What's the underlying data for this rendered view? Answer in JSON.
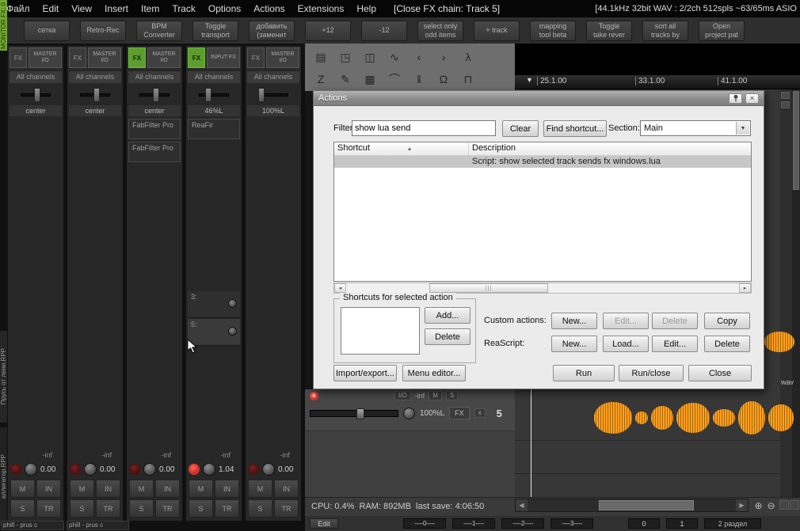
{
  "menu": {
    "items": [
      "Файл",
      "Edit",
      "View",
      "Insert",
      "Item",
      "Track",
      "Options",
      "Actions",
      "Extensions",
      "Help"
    ],
    "context": "[Close FX chain: Track 5]",
    "audio_status": "[44.1kHz 32bit WAV : 2/2ch 512spls ~63/65ms ASIO"
  },
  "toolbar": {
    "buttons": [
      "сетка",
      "Retro-Rec",
      "BPM\nConverter",
      "Toggle\ntransport",
      "добавить\n(заменит",
      "+12",
      "-12",
      "select only\nodd items",
      "+ track",
      "mapping\ntool beta",
      "Toggle\ntake rever",
      "sort all\ntracks by",
      "Open\nproject pat"
    ]
  },
  "side_tabs": {
    "monitor_fx": "MONITOR FX: 0",
    "project1": "Прусь от лени.RPP",
    "project2": "аллигатор.RPP"
  },
  "mixer": {
    "labels": {
      "mute": "M",
      "solo": "S",
      "input": "IN",
      "trim": "TR"
    },
    "strips": [
      {
        "fx": "FX",
        "io": "MASTER\nI/O",
        "channels": "All channels",
        "pan_label": "center",
        "vol": "-inf",
        "gain": "0.00"
      },
      {
        "fx": "FX",
        "io": "MASTER\nI/O",
        "channels": "All channels",
        "pan_label": "center",
        "vol": "-inf",
        "gain": "0.00"
      },
      {
        "fx": "FX",
        "io": "MASTER\nI/O",
        "channels": "All channels",
        "pan_label": "center",
        "vol": "-inf",
        "gain": "0.00",
        "slots": [
          "FabFilter Pro",
          "FabFilter Pro"
        ]
      },
      {
        "fx": "FX",
        "io": "INPUT FX",
        "channels": "All channels",
        "pan_label": "46%L",
        "vol": "-inf",
        "gain": "1.04",
        "slots": [
          "ReaFir"
        ],
        "sends": [
          "3:",
          "5:"
        ]
      },
      {
        "fx": "FX",
        "io": "MASTER\nI/O",
        "channels": "All channels",
        "pan_label": "100%L",
        "vol": "-inf",
        "gain": "0.00"
      }
    ]
  },
  "icon_rows": {
    "row1": [
      "▤",
      "◳",
      "◫",
      "∿",
      "‹",
      "›",
      "λ"
    ],
    "row2": [
      "Ζ",
      "✎",
      "▦",
      "⌒",
      "‖",
      "Ω",
      "⊓"
    ]
  },
  "ruler": {
    "marks": [
      "25.1.00",
      "33.1.00",
      "41.1.00"
    ],
    "flag": "▼"
  },
  "actions_dialog": {
    "title": "Actions",
    "close": "×",
    "filter_label": "Filter:",
    "filter_value": "show lua send",
    "clear_button": "Clear",
    "find_shortcut_button": "Find shortcut...",
    "section_label": "Section:",
    "section_value": "Main",
    "columns": [
      "Shortcut",
      "Description"
    ],
    "sort_arrow": "▴",
    "selected_description": "Script: show selected track sends fx windows.lua",
    "groupbox_title": "Shortcuts for selected action",
    "add_button": "Add...",
    "delete_button": "Delete",
    "custom_actions_label": "Custom actions:",
    "custom_new": "New...",
    "custom_edit": "Edit...",
    "custom_delete": "Delete",
    "custom_copy": "Copy",
    "reascript_label": "ReaScript:",
    "rs_new": "New...",
    "rs_load": "Load...",
    "rs_edit": "Edit...",
    "rs_delete": "Delete",
    "import_export_button": "Import/export...",
    "menu_editor_button": "Menu editor...",
    "run_button": "Run",
    "run_close_button": "Run/close",
    "close_button": "Close"
  },
  "track_panel": {
    "rec": "a",
    "io": "I/O",
    "vol": "-inf",
    "mute": "M",
    "solo": "S",
    "pan": "100%L",
    "fx": "FX",
    "fx_close": "x",
    "number": "5"
  },
  "arrange": {
    "item_label": "wav"
  },
  "status_bar": {
    "text": "CPU: 0.4%  RAM: 892MB  last save: 4:06:50"
  },
  "scrollbar": {
    "left_arrow": "◀",
    "right_arrow": "▶",
    "zoom_in": "⊕",
    "zoom_out": "⊖"
  },
  "transport": {
    "edit": "Edit",
    "fields": [
      "-----0-----",
      "-----1-----",
      "-----2-----",
      "-----3-----"
    ],
    "values": [
      "0",
      "1"
    ],
    "section": "2 раздел"
  },
  "bottom_items": [
    "phill - prus c",
    "phill - prus c"
  ],
  "colors": {
    "accent_orange": "#ffa024",
    "fx_green": "#5d9c2e",
    "record_red": "#d03030"
  }
}
